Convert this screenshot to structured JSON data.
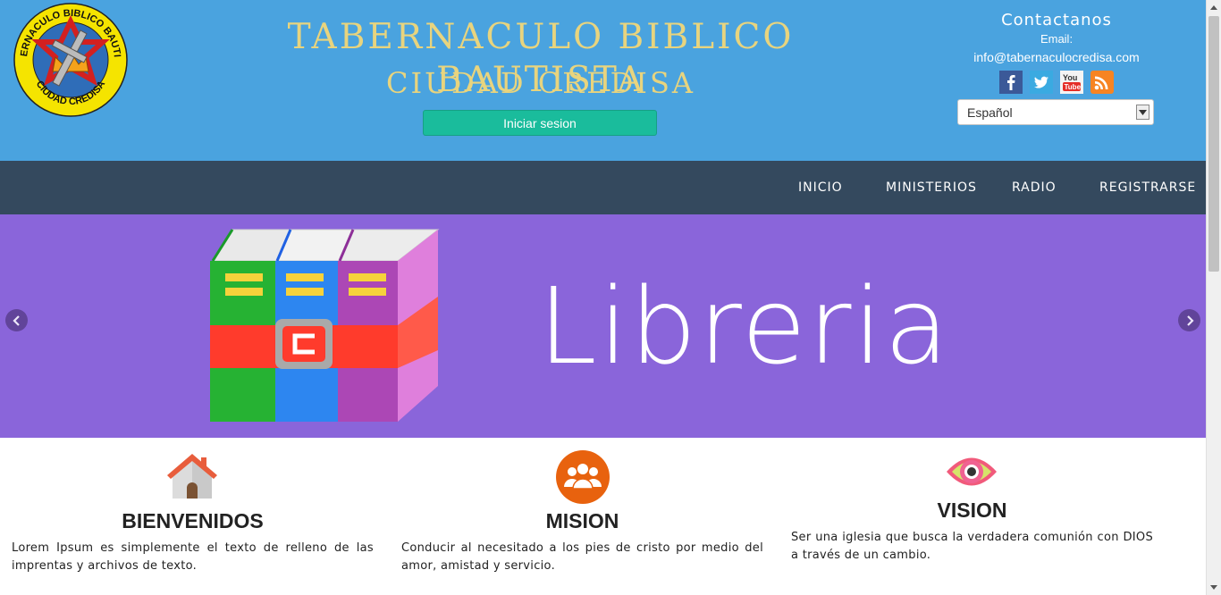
{
  "header": {
    "logo_text_top": "TABERNACULO BIBLICO BAUTISTA",
    "logo_text_bottom": "CIUDAD CREDISA",
    "title": "TABERNACULO BIBLICO BAUTISTA",
    "subtitle": "CIUDAD CREDISA",
    "login_label": "Iniciar sesion",
    "contact_title": "Contactanos",
    "email_label": "Email:",
    "email": "info@tabernaculocredisa.com",
    "social_icons": [
      "facebook-icon",
      "twitter-icon",
      "youtube-icon",
      "rss-icon"
    ],
    "language": "Español"
  },
  "nav": {
    "items": [
      "INICIO",
      "MINISTERIOS",
      "RADIO",
      "REGISTRARSE"
    ]
  },
  "banner": {
    "text": "Libreria",
    "background": "#8a65da"
  },
  "features": [
    {
      "icon": "house-icon",
      "title": "BIENVENIDOS",
      "text": "Lorem Ipsum es simplemente el texto de relleno de las imprentas y archivos de texto."
    },
    {
      "icon": "group-icon",
      "title": "MISION",
      "text": "Conducir al necesitado a los pies de cristo por medio del amor, amistad y servicio."
    },
    {
      "icon": "eye-icon",
      "title": "VISION",
      "text": "Ser una iglesia que busca la verdadera comunión con DIOS a través de un cambio."
    }
  ],
  "colors": {
    "header": "#4aa3df",
    "title": "#e8d47e",
    "login_button": "#1abc9c",
    "nav": "#34495e"
  }
}
